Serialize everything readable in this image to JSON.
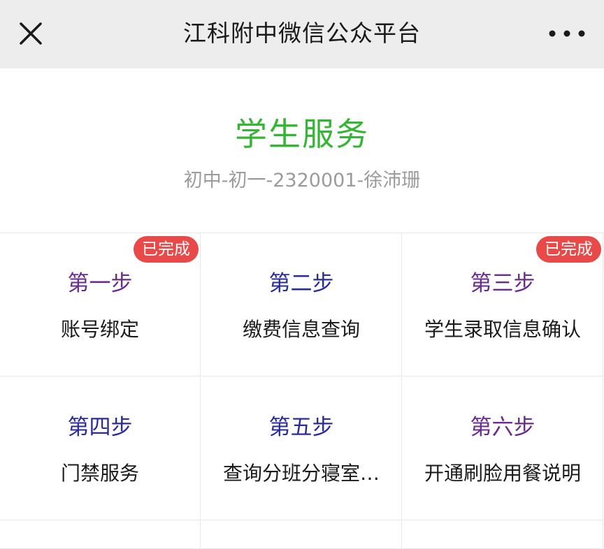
{
  "topbar": {
    "title": "江科附中微信公众平台",
    "close_icon": "close-icon",
    "more_icon": "more-dots-icon"
  },
  "page": {
    "title": "学生服务",
    "student_info": "初中-初一-2320001-徐沛珊"
  },
  "steps": [
    {
      "step": "第一步",
      "label": "账号绑定",
      "badge": "已完成",
      "step_color": "#6a2b8c"
    },
    {
      "step": "第二步",
      "label": "缴费信息查询",
      "badge": "",
      "step_color": "#2b2b9c"
    },
    {
      "step": "第三步",
      "label": "学生录取信息确认",
      "badge": "已完成",
      "step_color": "#6a2b8c"
    },
    {
      "step": "第四步",
      "label": "门禁服务",
      "badge": "",
      "step_color": "#2b2b9c"
    },
    {
      "step": "第五步",
      "label": "查询分班分寝室…",
      "badge": "",
      "step_color": "#2b2b9c"
    },
    {
      "step": "第六步",
      "label": "开通刷脸用餐说明",
      "badge": "",
      "step_color": "#6a2b8c"
    }
  ],
  "colors": {
    "accent_green": "#35b534",
    "badge_red": "#e84a4a"
  }
}
